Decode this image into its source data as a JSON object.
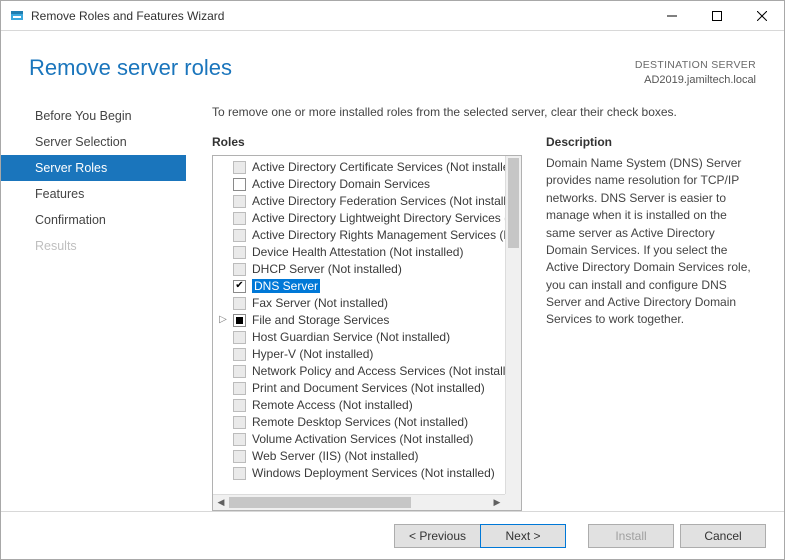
{
  "window": {
    "title": "Remove Roles and Features Wizard"
  },
  "header": {
    "page_title": "Remove server roles",
    "dest_label": "DESTINATION SERVER",
    "dest_value": "AD2019.jamiltech.local"
  },
  "nav": {
    "items": [
      {
        "label": "Before You Begin",
        "state": "normal"
      },
      {
        "label": "Server Selection",
        "state": "normal"
      },
      {
        "label": "Server Roles",
        "state": "active"
      },
      {
        "label": "Features",
        "state": "normal"
      },
      {
        "label": "Confirmation",
        "state": "normal"
      },
      {
        "label": "Results",
        "state": "disabled"
      }
    ]
  },
  "main": {
    "instruction": "To remove one or more installed roles from the selected server, clear their check boxes.",
    "roles_heading": "Roles",
    "desc_heading": "Description",
    "description": "Domain Name System (DNS) Server provides name resolution for TCP/IP networks. DNS Server is easier to manage when it is installed on the same server as Active Directory Domain Services. If you select the Active Directory Domain Services role, you can install and configure DNS Server and Active Directory Domain Services to work together."
  },
  "roles": [
    {
      "label": "Active Directory Certificate Services (Not installed)",
      "cb": "dim"
    },
    {
      "label": "Active Directory Domain Services",
      "cb": "empty"
    },
    {
      "label": "Active Directory Federation Services (Not installed)",
      "cb": "dim"
    },
    {
      "label": "Active Directory Lightweight Directory Services (Not installed)",
      "cb": "dim"
    },
    {
      "label": "Active Directory Rights Management Services (Not installed)",
      "cb": "dim"
    },
    {
      "label": "Device Health Attestation (Not installed)",
      "cb": "dim"
    },
    {
      "label": "DHCP Server (Not installed)",
      "cb": "dim"
    },
    {
      "label": "DNS Server",
      "cb": "checked",
      "selected": true
    },
    {
      "label": "Fax Server (Not installed)",
      "cb": "dim"
    },
    {
      "label": "File and Storage Services",
      "cb": "square",
      "expandable": true
    },
    {
      "label": "Host Guardian Service (Not installed)",
      "cb": "dim"
    },
    {
      "label": "Hyper-V (Not installed)",
      "cb": "dim"
    },
    {
      "label": "Network Policy and Access Services (Not installed)",
      "cb": "dim"
    },
    {
      "label": "Print and Document Services (Not installed)",
      "cb": "dim"
    },
    {
      "label": "Remote Access (Not installed)",
      "cb": "dim"
    },
    {
      "label": "Remote Desktop Services (Not installed)",
      "cb": "dim"
    },
    {
      "label": "Volume Activation Services (Not installed)",
      "cb": "dim"
    },
    {
      "label": "Web Server (IIS) (Not installed)",
      "cb": "dim"
    },
    {
      "label": "Windows Deployment Services (Not installed)",
      "cb": "dim"
    }
  ],
  "footer": {
    "previous": "< Previous",
    "next": "Next >",
    "install": "Install",
    "cancel": "Cancel"
  }
}
